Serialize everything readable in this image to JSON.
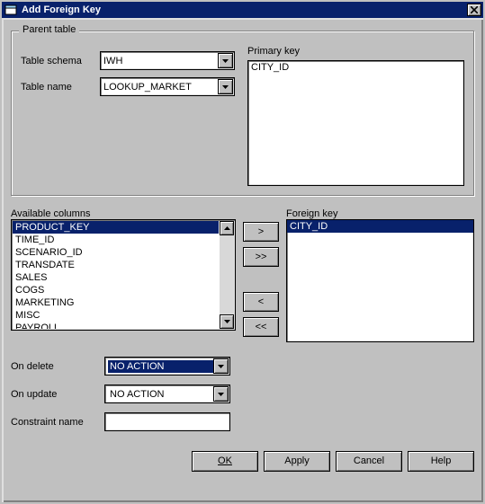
{
  "title": "Add Foreign Key",
  "groupbox_label": "Parent table",
  "labels": {
    "table_schema": "Table schema",
    "table_name": "Table name",
    "primary_key": "Primary key",
    "available_columns": "Available columns",
    "foreign_key": "Foreign key",
    "on_delete": "On delete",
    "on_update": "On update",
    "constraint_name": "Constraint name"
  },
  "values": {
    "table_schema": "IWH",
    "table_name": "LOOKUP_MARKET",
    "on_delete": "NO ACTION",
    "on_update": "NO ACTION",
    "constraint_name": ""
  },
  "primary_key_items": [
    "CITY_ID"
  ],
  "available_columns": [
    "PRODUCT_KEY",
    "TIME_ID",
    "SCENARIO_ID",
    "TRANSDATE",
    "SALES",
    "COGS",
    "MARKETING",
    "MISC",
    "PAYROLL"
  ],
  "available_selected_index": 0,
  "foreign_key_items": [
    "CITY_ID"
  ],
  "foreign_selected_index": 0,
  "transfer": {
    "add": ">",
    "add_all": ">>",
    "remove": "<",
    "remove_all": "<<"
  },
  "buttons": {
    "ok": "OK",
    "apply": "Apply",
    "cancel": "Cancel",
    "help": "Help"
  }
}
